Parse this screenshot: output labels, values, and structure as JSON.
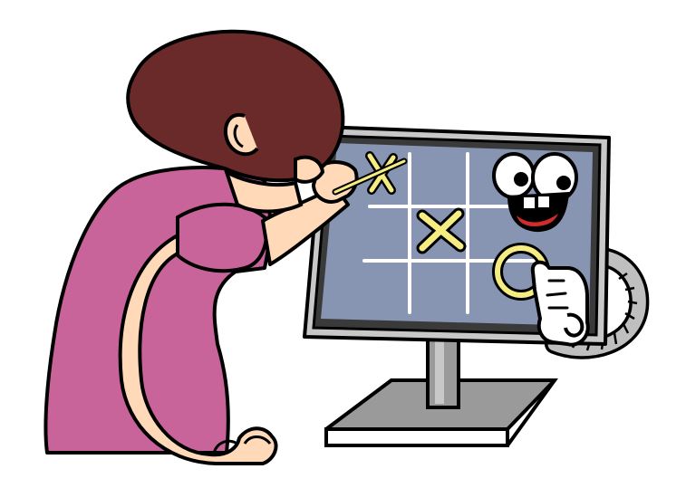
{
  "scene": {
    "subject": "illustration",
    "board": {
      "cells": [
        [
          "X",
          "",
          ""
        ],
        [
          "",
          "X",
          ""
        ],
        [
          "",
          "",
          "O"
        ]
      ]
    },
    "colors": {
      "background": "#ffffff",
      "outline": "#000000",
      "hair": "#6b2a2a",
      "shirt": "#c9649b",
      "skin": "#ffd9b8",
      "monitor_frame": "#c8c8c8",
      "monitor_bezel": "#3a3a3a",
      "screen": "#8795b3",
      "grid_lines": "#ffffff",
      "marks": "#f5ec82",
      "stand": "#9a9a9a",
      "face_mouth": "#d22b2b",
      "glove": "#ffffff"
    },
    "icons": [
      "x-mark-icon",
      "o-mark-icon",
      "cartoon-face-icon",
      "robot-glove-icon"
    ]
  }
}
